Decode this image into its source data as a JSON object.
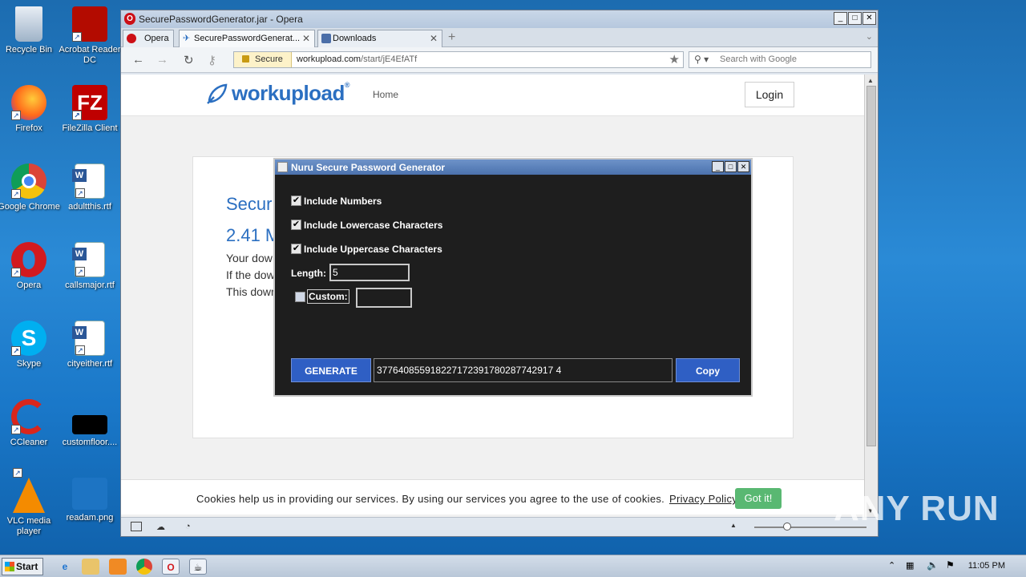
{
  "desktop": {
    "icons": [
      {
        "label": "Recycle Bin"
      },
      {
        "label": "Acrobat Reader DC"
      },
      {
        "label": "Firefox"
      },
      {
        "label": "FileZilla Client"
      },
      {
        "label": "Google Chrome"
      },
      {
        "label": "adultthis.rtf"
      },
      {
        "label": "Opera"
      },
      {
        "label": "callsmajor.rtf"
      },
      {
        "label": "Skype"
      },
      {
        "label": "cityeither.rtf"
      },
      {
        "label": "CCleaner"
      },
      {
        "label": "customfloor...."
      },
      {
        "label": "VLC media player"
      },
      {
        "label": "readam.png"
      }
    ]
  },
  "browser": {
    "window_title": "SecurePasswordGenerator.jar - Opera",
    "menu_button": "Opera",
    "tabs": [
      {
        "label": "SecurePasswordGenerat..."
      },
      {
        "label": "Downloads"
      }
    ],
    "secure_label": "Secure",
    "url_host": "workupload.com",
    "url_path": "/start/jE4EfATf",
    "search_placeholder": "Search with Google"
  },
  "site": {
    "logo": "workupload",
    "logo_mark": "®",
    "nav_home": "Home",
    "login": "Login",
    "heading_line1": "Secur",
    "heading_line2": "2.41 M",
    "para_line1": "Your dow",
    "para_line2": "If the dow",
    "para_line3": "This down",
    "cookie_text": "Cookies help us in providing our services. By using our services you agree to the use of cookies.",
    "cookie_link": "Privacy Policy",
    "cookie_button": "Got it!"
  },
  "dialog": {
    "title": "Nuru Secure Password Generator",
    "include_numbers": "Include Numbers",
    "include_lowercase": "Include Lowercase Characters",
    "include_uppercase": "Include Uppercase Characters",
    "length_label": "Length:",
    "length_value": "5",
    "custom_label": "Custom:",
    "custom_value": "",
    "generate_button": "GENERATE",
    "output": "377640855918227172391780287742917 4",
    "copy_button": "Copy"
  },
  "taskbar": {
    "start": "Start",
    "clock": "11:05 PM"
  },
  "watermark": "ANY RUN"
}
